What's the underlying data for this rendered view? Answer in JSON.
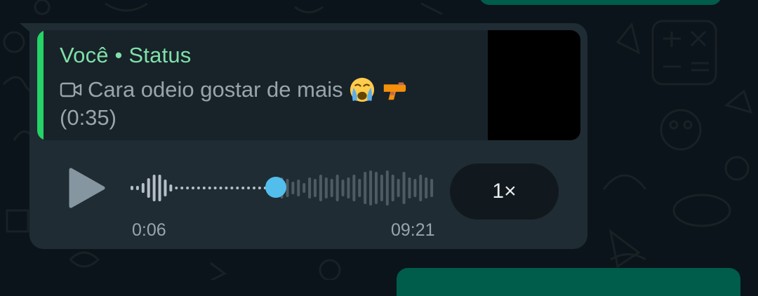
{
  "reply": {
    "title": "Você • Status",
    "caption": "Cara odeio gostar de mais",
    "duration": "(0:35)",
    "icons": [
      "video-camera-icon",
      "crying-face-emoji",
      "water-pistol-emoji"
    ]
  },
  "audio": {
    "elapsed": "0:06",
    "total": "09:21",
    "progress": 0.47,
    "speed_label": "1×",
    "play_icon": "play-icon"
  },
  "colors": {
    "bubble": "#1f2c34",
    "quote_accent": "#25d366",
    "quote_title": "#7fe0a8",
    "progress_knob": "#53bdeb",
    "outgoing_bubble": "#005c4b"
  }
}
